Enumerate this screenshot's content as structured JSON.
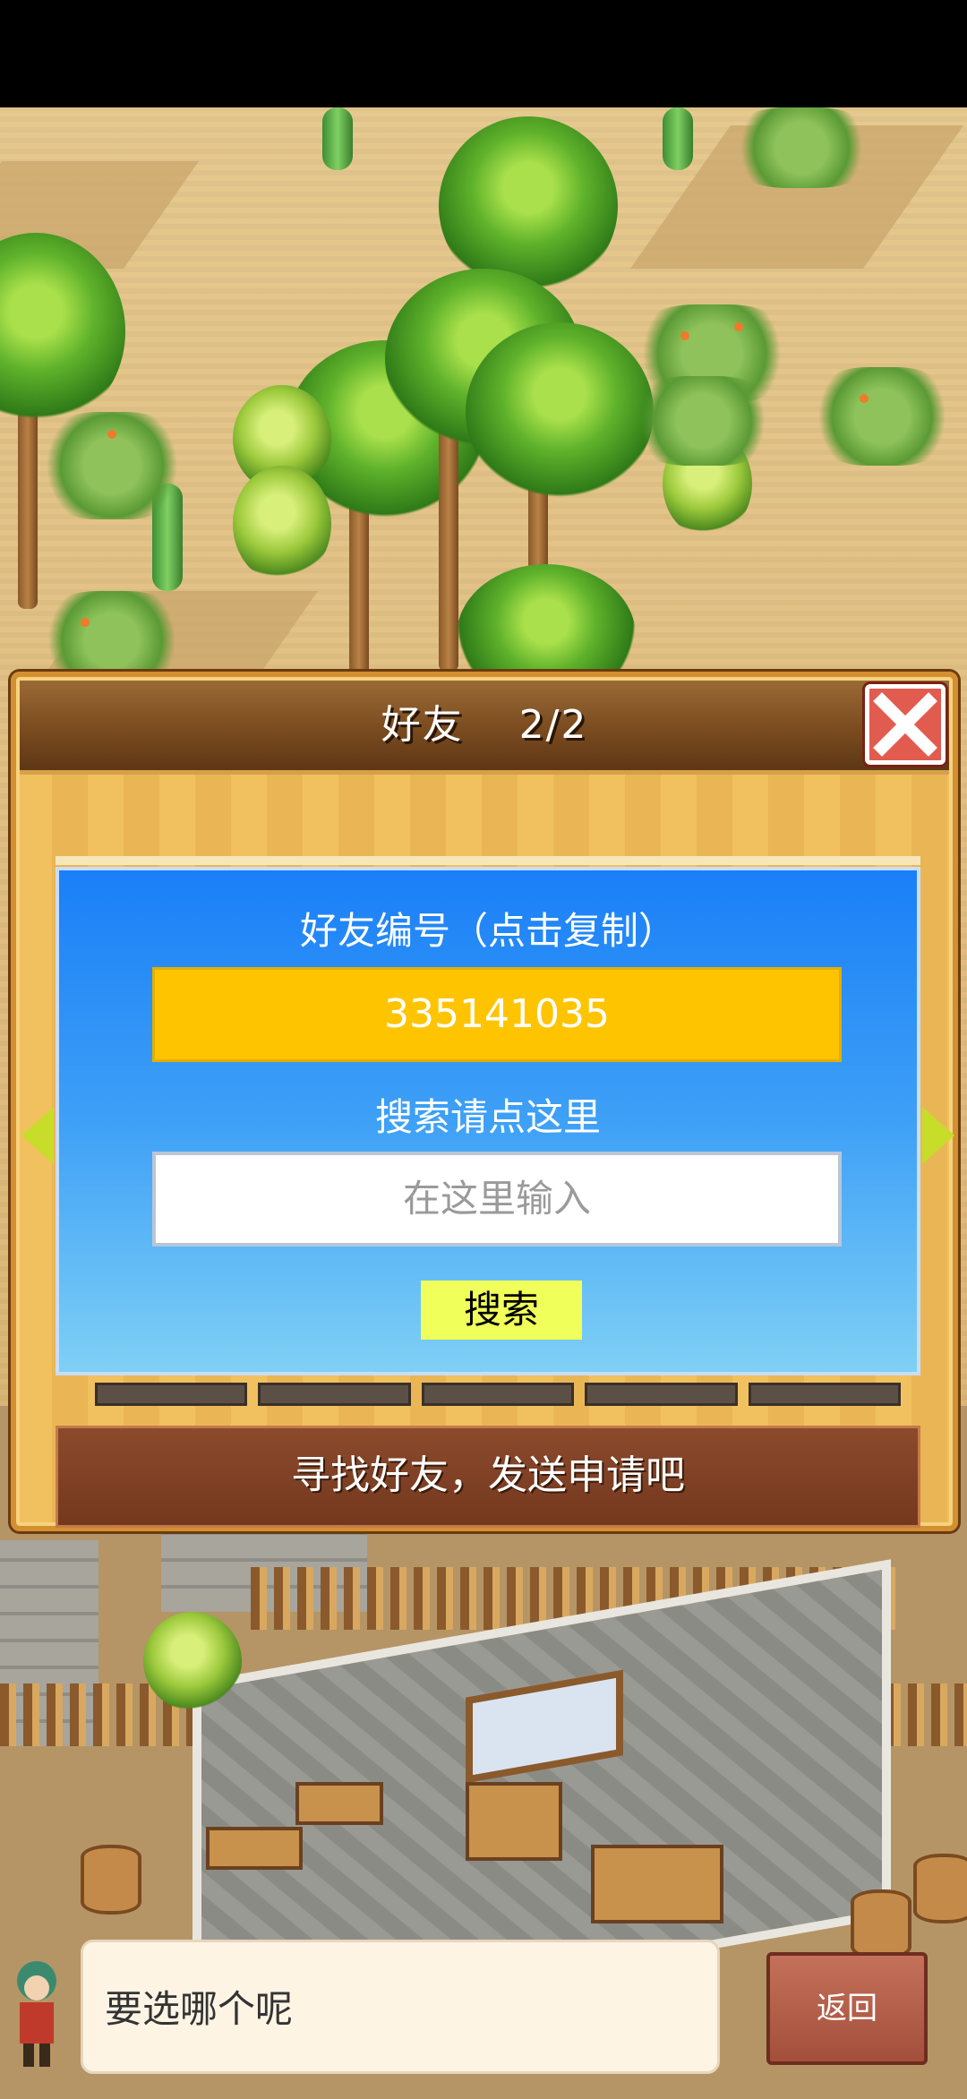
{
  "dialog": {
    "title": "好友　 2/2",
    "close_icon": "close-icon",
    "friend_id_label": "好友编号（点击复制）",
    "friend_id": "335141035",
    "search_label": "搜索请点这里",
    "search_placeholder": "在这里输入",
    "search_button": "搜索",
    "bottom_button": "寻找好友，发送申请吧"
  },
  "footer": {
    "prompt": "要选哪个呢",
    "back_button": "返回"
  },
  "colors": {
    "id_box": "#ffc400",
    "search_button": "#f1ff5a",
    "close_button": "#e25b4f"
  }
}
